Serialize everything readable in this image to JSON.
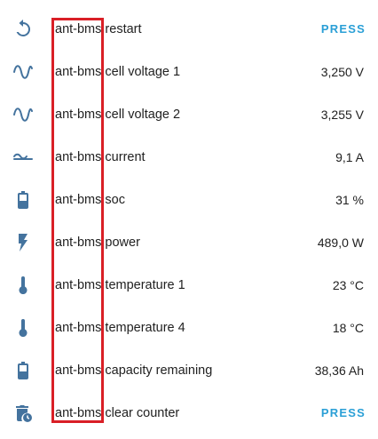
{
  "colors": {
    "icon": "#44739e",
    "accent": "#2a9fd6",
    "highlight": "#d91f26",
    "text": "#212121"
  },
  "entities": [
    {
      "prefix": "ant-bms",
      "label": "restart",
      "icon": "restart-icon",
      "action": "PRESS"
    },
    {
      "prefix": "ant-bms",
      "label": "cell voltage 1",
      "icon": "sine-wave-icon",
      "value": "3,250 V"
    },
    {
      "prefix": "ant-bms",
      "label": "cell voltage 2",
      "icon": "sine-wave-icon",
      "value": "3,255 V"
    },
    {
      "prefix": "ant-bms",
      "label": "current",
      "icon": "current-ac-icon",
      "value": "9,1 A"
    },
    {
      "prefix": "ant-bms",
      "label": "soc",
      "icon": "battery-icon",
      "value": "31 %"
    },
    {
      "prefix": "ant-bms",
      "label": "power",
      "icon": "lightning-bolt-icon",
      "value": "489,0 W"
    },
    {
      "prefix": "ant-bms",
      "label": "temperature 1",
      "icon": "thermometer-icon",
      "value": "23 °C"
    },
    {
      "prefix": "ant-bms",
      "label": "temperature 4",
      "icon": "thermometer-icon",
      "value": "18 °C"
    },
    {
      "prefix": "ant-bms",
      "label": "capacity remaining",
      "icon": "battery-icon",
      "value": "38,36 Ah"
    },
    {
      "prefix": "ant-bms",
      "label": "clear counter",
      "icon": "delete-clock-icon",
      "action": "PRESS"
    }
  ]
}
